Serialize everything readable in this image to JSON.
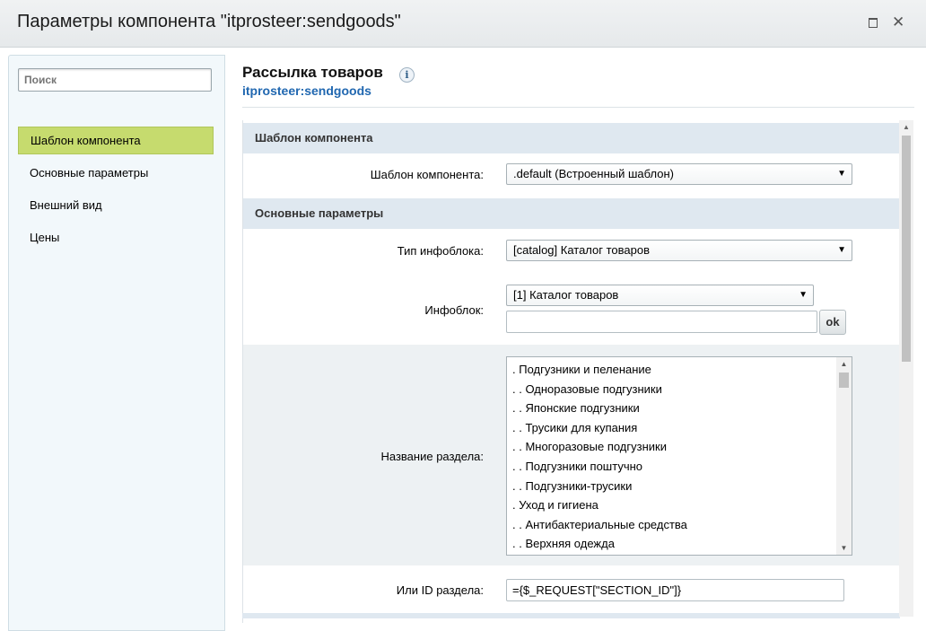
{
  "window": {
    "title": "Параметры компонента \"itprosteer:sendgoods\"",
    "maximize_icon": "maximize-icon",
    "close_glyph": "✕"
  },
  "sidebar": {
    "search_placeholder": "Поиск",
    "items": [
      {
        "label": "Шаблон компонента",
        "active": true
      },
      {
        "label": "Основные параметры",
        "active": false
      },
      {
        "label": "Внешний вид",
        "active": false
      },
      {
        "label": "Цены",
        "active": false
      }
    ],
    "active_color": "#c6db6e"
  },
  "main": {
    "heading": "Рассылка товаров",
    "info_glyph": "i",
    "subheading": "itprosteer:sendgoods",
    "sections": {
      "template": "Шаблон компонента",
      "basic": "Основные параметры"
    },
    "fields": {
      "template_label": "Шаблон компонента:",
      "template_value": ".default (Встроенный шаблон)",
      "iblock_type_label": "Тип инфоблока:",
      "iblock_type_value": "[catalog] Каталог товаров",
      "iblock_label": "Инфоблок:",
      "iblock_value": "[1] Каталог товаров",
      "iblock_text_value": "",
      "ok_label": "ok",
      "section_name_label": "Название раздела:",
      "section_id_label": "Или ID раздела:",
      "section_id_value": "={$_REQUEST[\"SECTION_ID\"]}"
    },
    "section_list": [
      ". Подгузники и пеленание",
      ". . Одноразовые подгузники",
      ". . Японские подгузники",
      ". . Трусики для купания",
      ". . Многоразовые подгузники",
      ". . Подгузники поштучно",
      ". . Подгузники-трусики",
      ". Уход и гигиена",
      ". . Антибактериальные средства",
      ". . Верхняя одежда"
    ],
    "accent_color": "#2067b0",
    "section_bg": "#dfe8f0"
  }
}
